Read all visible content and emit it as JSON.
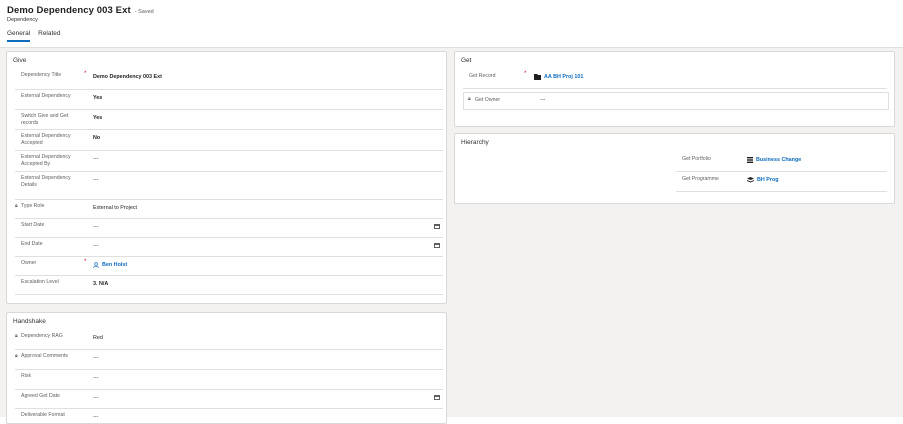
{
  "header": {
    "title": "Demo Dependency 003 Ext",
    "saved_status": "- Saved",
    "entity": "Dependency",
    "tabs": [
      {
        "label": "General"
      },
      {
        "label": "Related"
      }
    ]
  },
  "give": {
    "title": "Give",
    "fields": {
      "dependency_title": {
        "label": "Dependency Title",
        "value": "Demo Dependency 003 Ext"
      },
      "external_dependency": {
        "label": "External Dependency",
        "value": "Yes"
      },
      "switch_give_get": {
        "label": "Switch Give and Get records",
        "value": "Yes"
      },
      "external_accepted": {
        "label": "External Dependency Accepted",
        "value": "No"
      },
      "external_accepted_by": {
        "label": "External Dependency Accepted By",
        "value": "---"
      },
      "external_details": {
        "label": "External Dependency Details",
        "value": "---"
      },
      "type_role": {
        "label": "Type Role",
        "value": "External to Project"
      },
      "start_date": {
        "label": "Start Date",
        "value": "---"
      },
      "end_date": {
        "label": "End Date",
        "value": "---"
      },
      "owner": {
        "label": "Owner",
        "value": "Ben Holst"
      },
      "escalation_level": {
        "label": "Escalation Level",
        "value": "3. N/A"
      }
    }
  },
  "handshake": {
    "title": "Handshake",
    "fields": {
      "dependency_rag": {
        "label": "Dependency RAG",
        "value": "Red"
      },
      "approval_comments": {
        "label": "Approval Comments",
        "value": "---"
      },
      "risk": {
        "label": "Risk",
        "value": "---"
      },
      "agreed_get_date": {
        "label": "Agreed Get Date",
        "value": "---"
      },
      "deliverable_format": {
        "label": "Deliverable Format",
        "value": "---"
      }
    }
  },
  "get": {
    "title": "Get",
    "get_record": {
      "label": "Get Record",
      "value": "AA BH Proj 101"
    },
    "get_owner": {
      "label": "Get Owner",
      "value": "---"
    }
  },
  "hierarchy": {
    "title": "Hierarchy",
    "get_portfolio": {
      "label": "Get Portfolio",
      "value": "Business Change"
    },
    "get_programme": {
      "label": "Get Programme",
      "value": "BH Prog"
    }
  },
  "colors": {
    "accent": "#0f6cbd",
    "required": "#c50f1f"
  }
}
